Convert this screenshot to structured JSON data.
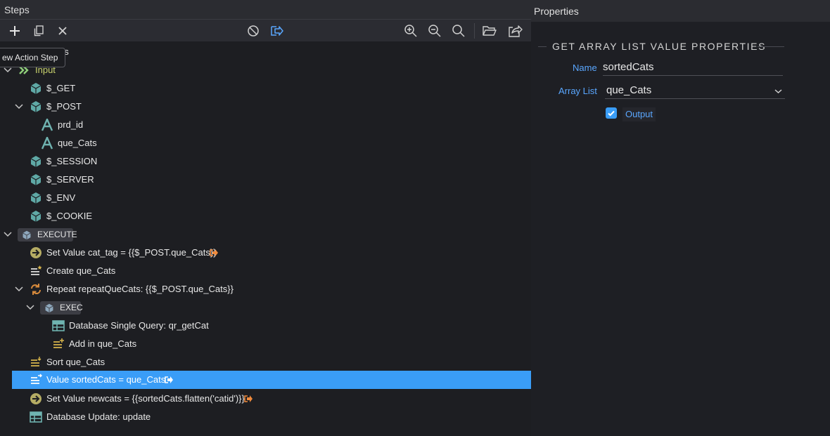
{
  "steps_panel": {
    "title": "Steps",
    "tooltip": "ew Action Step",
    "partial_hidden_label": "gs"
  },
  "toolbar": {
    "icons": [
      "add-icon",
      "copy-icon",
      "close-icon",
      "disable-icon",
      "output-icon",
      "zoom-in-icon",
      "zoom-out-icon",
      "zoom-fit-icon",
      "open-folder-icon",
      "export-icon"
    ]
  },
  "tree": {
    "input": "Input",
    "get": "$_GET",
    "post": "$_POST",
    "prd_id": "prd_id",
    "que_cats": "que_Cats",
    "session": "$_SESSION",
    "server": "$_SERVER",
    "env": "$_ENV",
    "cookie": "$_COOKIE",
    "execute": "EXECUTE",
    "set_cat_tag": "Set Value cat_tag = {{$_POST.que_Cats}}",
    "create_que_cats": "Create que_Cats",
    "repeat": "Repeat repeatQueCats: {{$_POST.que_Cats}}",
    "exec": "EXEC",
    "db_single_query": "Database Single Query: qr_getCat",
    "add_in_que_cats": "Add in que_Cats",
    "sort_que_cats": "Sort que_Cats",
    "value_sorted": "Value sortedCats = que_Cats",
    "set_newcats": "Set Value newcats = {{sortedCats.flatten('catid')}}",
    "db_update": "Database Update: update"
  },
  "properties_panel": {
    "title": "Properties",
    "section_title": "GET ARRAY LIST VALUE PROPERTIES",
    "name_label": "Name",
    "name_value": "sortedCats",
    "array_list_label": "Array List",
    "array_list_value": "que_Cats",
    "output_label": "Output",
    "output_checked": true
  },
  "colors": {
    "accent": "#3a9df7",
    "link_label": "#5aa7ff",
    "input_arrow": "#8fcf7a",
    "module_icon": "#6fb3b0",
    "action_icon": "#c9b463",
    "output_arrow": "#f08a3c"
  }
}
